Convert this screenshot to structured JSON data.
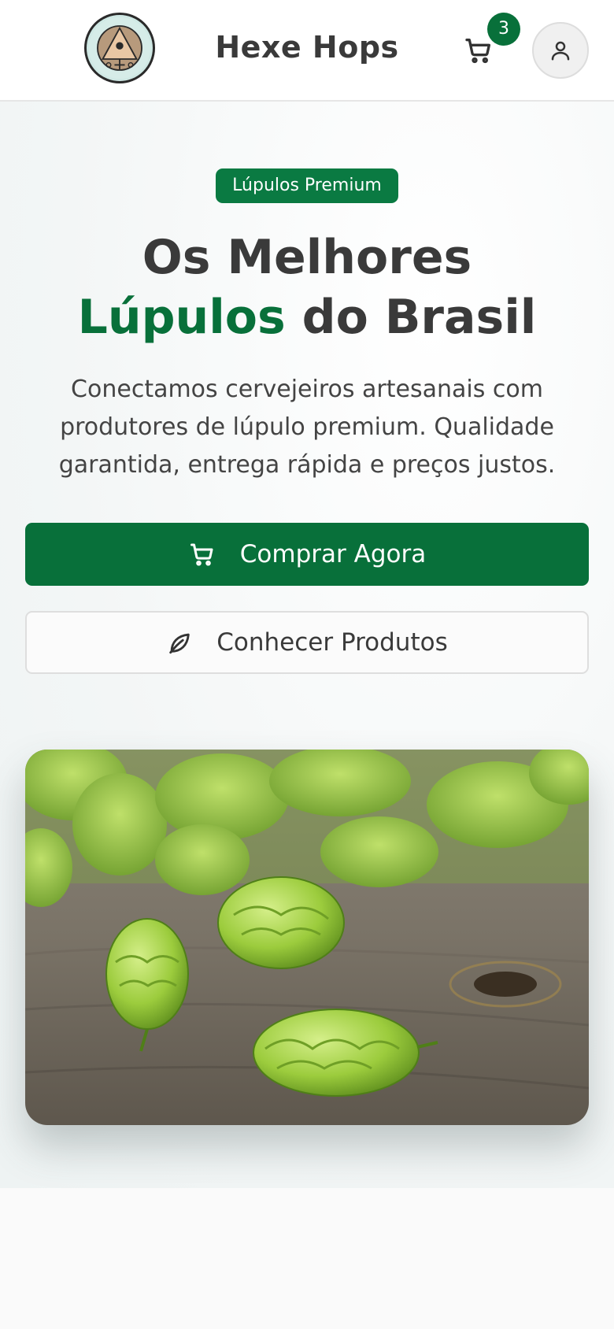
{
  "header": {
    "brand": "Hexe Hops",
    "logo_text": "Hexe Hops",
    "cart_count": "3",
    "icons": {
      "cart": "cart-icon",
      "user": "user-icon"
    }
  },
  "hero": {
    "badge": "Lúpulos Premium",
    "title_line1": "Os Melhores",
    "title_accent": "Lúpulos",
    "title_rest": " do Brasil",
    "description": "Conectamos cervejeiros artesanais com produtores de lúpulo premium. Qualidade garantida, entrega rápida e preços justos.",
    "primary_button": "Comprar Agora",
    "secondary_button": "Conhecer Produtos",
    "image_alt": "hops-photo"
  },
  "colors": {
    "accent": "#08703a",
    "text": "#3a3a3a",
    "background": "#fafafa"
  }
}
